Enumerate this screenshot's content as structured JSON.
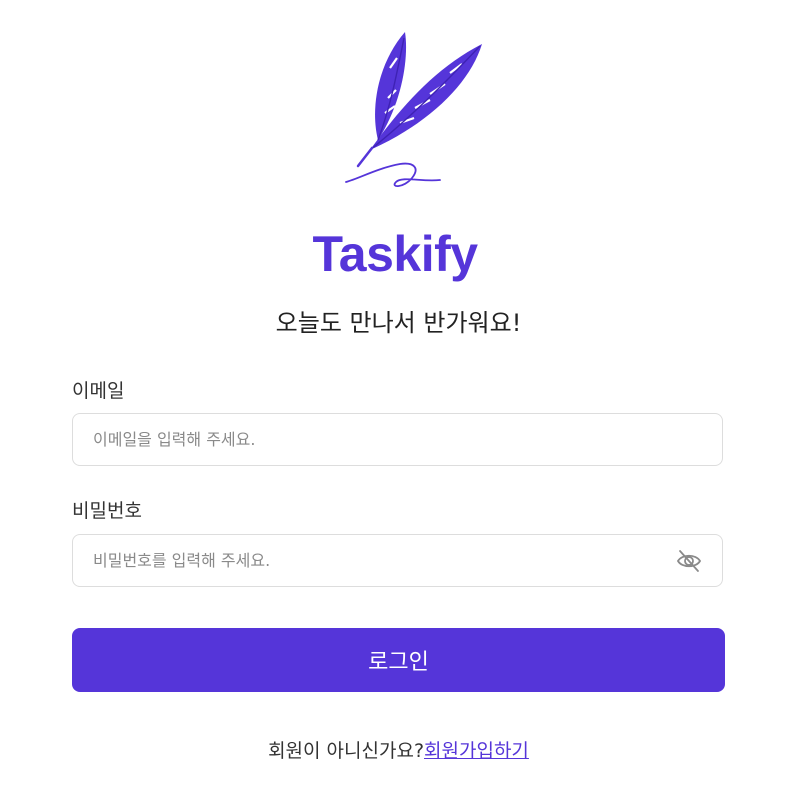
{
  "brand": {
    "logo_icon": "quill-pen-icon",
    "name": "Taskify",
    "accent_color": "#5535d9"
  },
  "greeting": "오늘도 만나서 반가워요!",
  "form": {
    "email": {
      "label": "이메일",
      "placeholder": "이메일을 입력해 주세요.",
      "value": ""
    },
    "password": {
      "label": "비밀번호",
      "placeholder": "비밀번호를 입력해 주세요.",
      "value": "",
      "toggle_icon": "eye-off-icon"
    },
    "submit_label": "로그인"
  },
  "signup": {
    "prompt": "회원이 아니신가요?",
    "link_label": "회원가입하기"
  }
}
